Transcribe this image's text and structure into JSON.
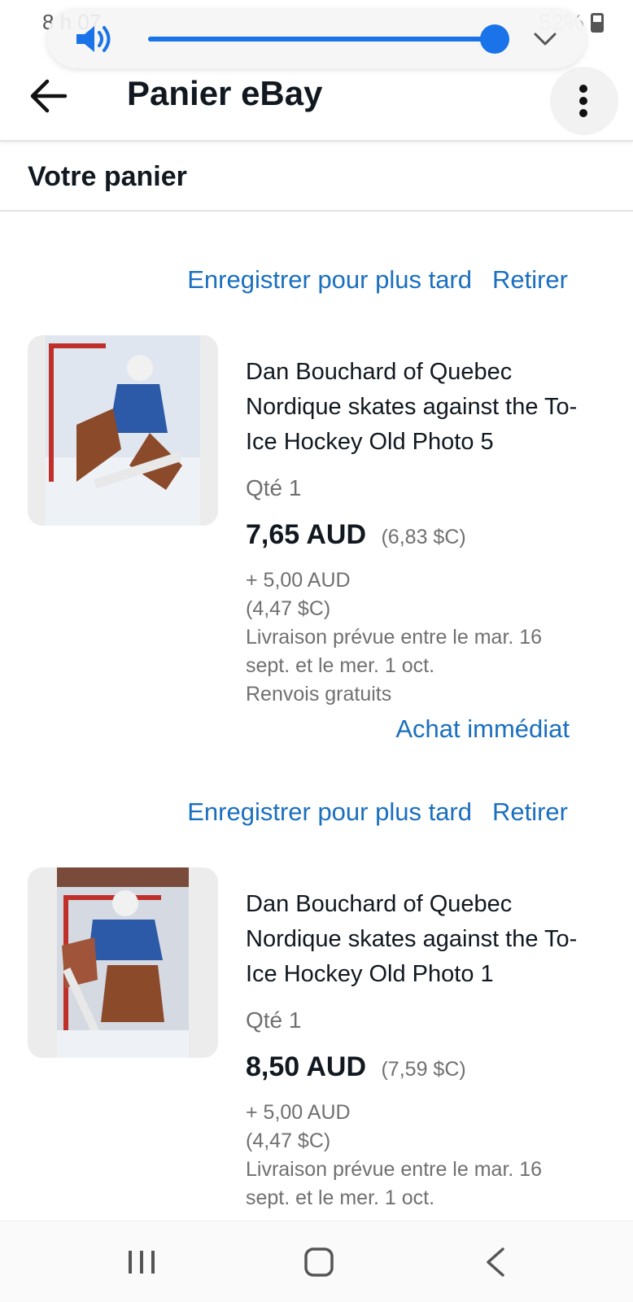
{
  "status_bar": {
    "time": "8 h 07",
    "battery": "52%"
  },
  "volume": {
    "level_fraction": 0.95,
    "icon": "volume-icon"
  },
  "header": {
    "title": "Panier eBay",
    "back_icon": "arrow-left-icon",
    "more_icon": "more-vertical-icon"
  },
  "section": {
    "title": "Votre panier"
  },
  "colors": {
    "link": "#1a6fbf",
    "accent": "#1a73e8",
    "muted_text": "#707070",
    "primary_text": "#111820"
  },
  "cart": {
    "items": [
      {
        "save_label": "Enregistrer pour plus tard",
        "remove_label": "Retirer",
        "title": "Dan Bouchard of Quebec Nordique skates against the To- Ice Hockey Old Photo 5",
        "qty": "Qté 1",
        "price": "7,65 AUD",
        "price_converted": "(6,83 $C)",
        "shipping_line1": "+ 5,00 AUD",
        "shipping_line2": "(4,47 $C)",
        "delivery": "Livraison prévue entre le mar. 16 sept. et le mer. 1 oct.",
        "returns": "Renvois gratuits",
        "buy_now_label": "Achat immédiat"
      },
      {
        "save_label": "Enregistrer pour plus tard",
        "remove_label": "Retirer",
        "title": "Dan Bouchard of Quebec Nordique skates against the To- Ice Hockey Old Photo 1",
        "qty": "Qté 1",
        "price": "8,50 AUD",
        "price_converted": "(7,59 $C)",
        "shipping_line1": "+ 5,00 AUD",
        "shipping_line2": "(4,47 $C)",
        "delivery": "Livraison prévue entre le mar. 16 sept. et le mer. 1 oct."
      }
    ]
  },
  "nav": {
    "recents_icon": "recents-icon",
    "home_icon": "home-icon",
    "back_icon": "nav-back-icon"
  }
}
